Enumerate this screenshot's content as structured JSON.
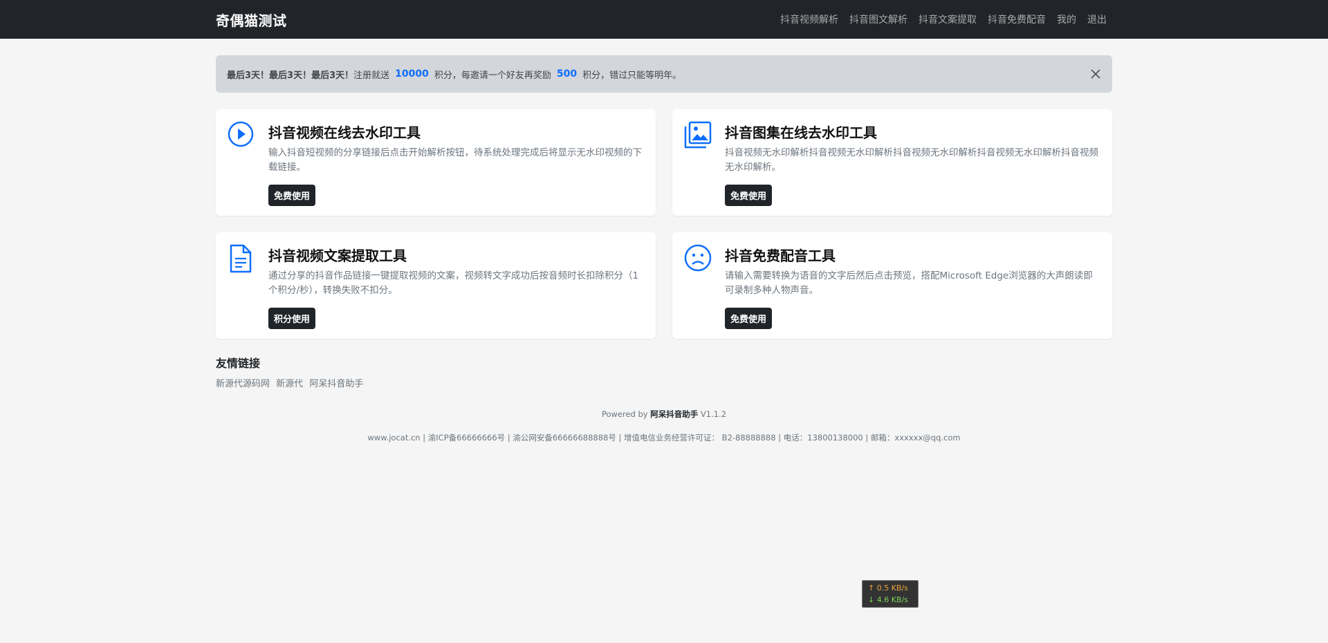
{
  "nav": {
    "brand": "奇偶猫测试",
    "links": [
      "抖音视频解析",
      "抖音图文解析",
      "抖音文案提取",
      "抖音免费配音",
      "我的",
      "退出"
    ]
  },
  "alert": {
    "strong": "最后3天！最后3天！最后3天！",
    "text1": "注册就送",
    "num1": "10000",
    "text2": "积分，每邀请一个好友再奖励",
    "num2": "500",
    "text3": "积分，错过只能等明年。",
    "close_icon": "close-icon"
  },
  "tools": [
    {
      "icon": "play-circle-icon",
      "title": "抖音视频在线去水印工具",
      "desc": "输入抖音短视频的分享链接后点击开始解析按钮，待系统处理完成后将显示无水印视频的下载链接。",
      "button": "免费使用"
    },
    {
      "icon": "images-icon",
      "title": "抖音图集在线去水印工具",
      "desc": "抖音视频无水印解析抖音视频无水印解析抖音视频无水印解析抖音视频无水印解析抖音视频无水印解析。",
      "button": "免费使用"
    },
    {
      "icon": "document-icon",
      "title": "抖音视频文案提取工具",
      "desc": "通过分享的抖音作品链接一键提取视频的文案，视频转文字成功后按音频时长扣除积分（1个积分/秒），转换失败不扣分。",
      "button": "积分使用"
    },
    {
      "icon": "frown-face-icon",
      "title": "抖音免费配音工具",
      "desc": "请输入需要转换为语音的文字后然后点击预览，搭配Microsoft Edge浏览器的大声朗读即可录制多种人物声音。",
      "button": "免费使用"
    }
  ],
  "friend_links": {
    "heading": "友情链接",
    "items": [
      "新源代源码网",
      "新源代",
      "阿呆抖音助手"
    ]
  },
  "footer": {
    "powered_prefix": "Powered by",
    "powered_name": "阿呆抖音助手",
    "version": "V1.1.2",
    "beian": "www.jocat.cn | 渝ICP备66666666号 | 渝公网安备66666688888号 | 增值电信业务经营许可证： B2-88888888 | 电话：13800138000 | 邮箱：xxxxxx@qq.com"
  },
  "netspeed": {
    "up": "↑ 0.5 KB/s",
    "down": "↓ 4.6 KB/s"
  },
  "colors": {
    "accent": "#0d6efd",
    "navbar": "#212529",
    "alert_bg": "#d3d6db"
  }
}
